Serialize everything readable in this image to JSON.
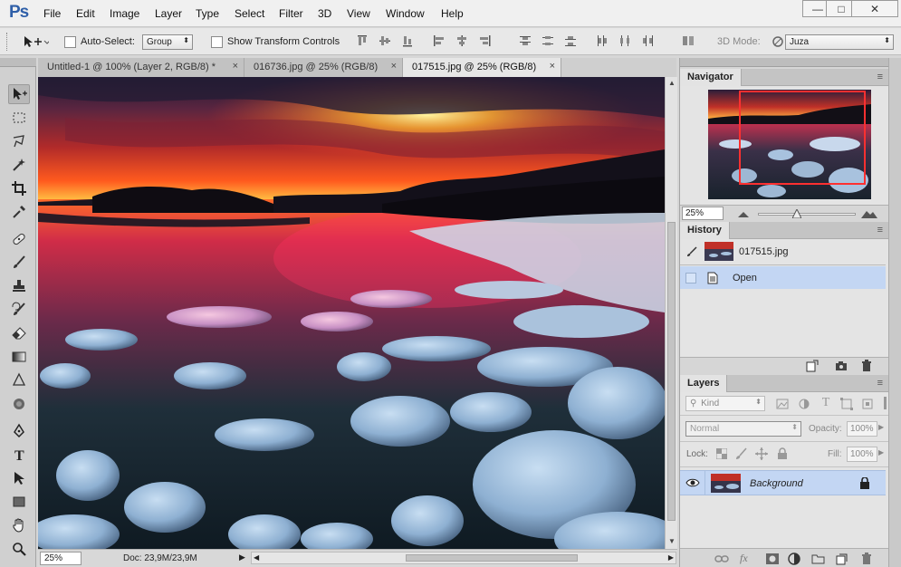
{
  "app": {
    "logo": "Ps"
  },
  "menu": [
    "File",
    "Edit",
    "Image",
    "Layer",
    "Type",
    "Select",
    "Filter",
    "3D",
    "View",
    "Window",
    "Help"
  ],
  "window_controls": {
    "minimize": "—",
    "maximize": "□",
    "close": "✕"
  },
  "options_bar": {
    "auto_select_label": "Auto-Select:",
    "auto_select_value": "Group",
    "show_transform_label": "Show Transform Controls",
    "mode_3d_label": "3D Mode:",
    "workspace_value": "Juza"
  },
  "tabs": [
    {
      "label": "Untitled-1 @ 100% (Layer 2, RGB/8) *",
      "close": "×"
    },
    {
      "label": "016736.jpg @ 25% (RGB/8)",
      "close": "×"
    },
    {
      "label": "017515.jpg @ 25% (RGB/8)",
      "close": "×"
    }
  ],
  "status": {
    "zoom": "25%",
    "doc": "Doc: 23,9M/23,9M"
  },
  "navigator": {
    "title": "Navigator",
    "zoom": "25%"
  },
  "history": {
    "title": "History",
    "snapshot": "017515.jpg",
    "step": "Open"
  },
  "layers": {
    "title": "Layers",
    "filter_kind": "Kind",
    "blend_mode": "Normal",
    "opacity_label": "Opacity:",
    "opacity_value": "100%",
    "lock_label": "Lock:",
    "fill_label": "Fill:",
    "fill_value": "100%",
    "layer_name": "Background",
    "footer_fx": "fx"
  },
  "colors": {
    "accent_select": "#c3d6f3",
    "brand": "#2f5fa8"
  }
}
